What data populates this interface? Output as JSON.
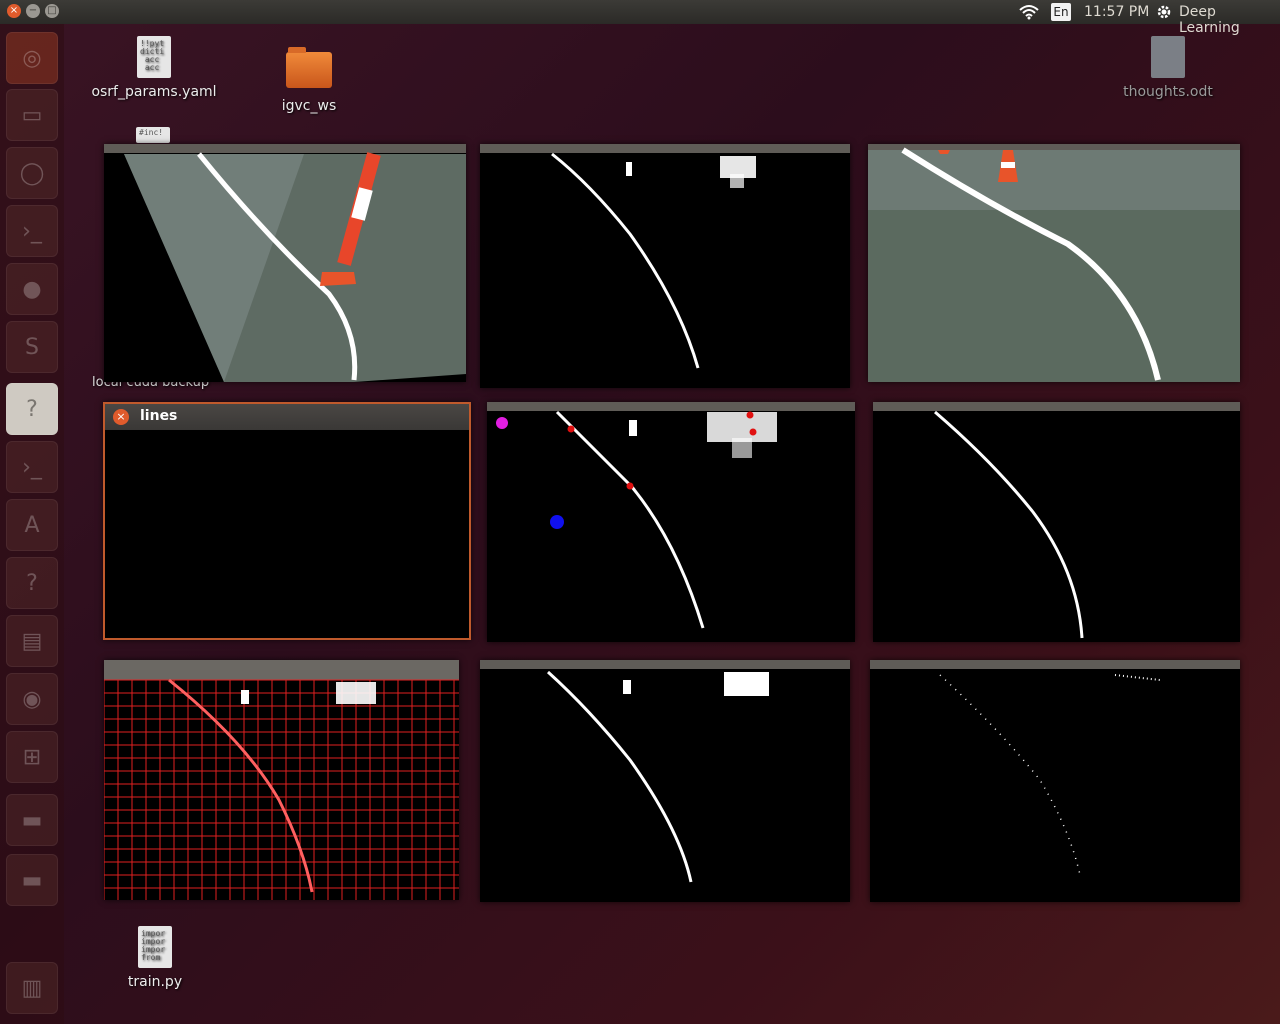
{
  "window_controls": {
    "close": "×",
    "minimize": "−",
    "maximize": "□"
  },
  "top_panel": {
    "keyboard_layout": "En",
    "clock": "11:57 PM",
    "session_user": "Deep Learning"
  },
  "desktop_icons": [
    {
      "label": "osrf_params.yaml",
      "preview": "!!pyt\ndicti\n acc\n acc"
    },
    {
      "label": "igvc_ws"
    },
    {
      "label": "thoughts.odt"
    },
    {
      "label": "local cuda backup"
    },
    {
      "label": "train.py",
      "preview": "impor\nimpor\nimpor\nfrom"
    }
  ],
  "partial_label": "#inc!",
  "lines_window": {
    "title": "lines"
  }
}
